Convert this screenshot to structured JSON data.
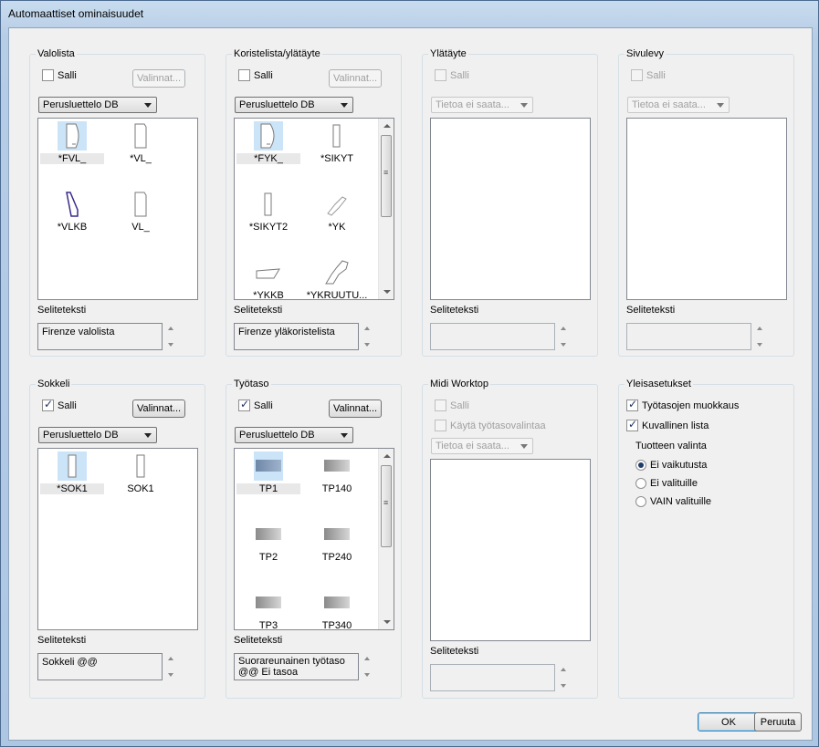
{
  "window": {
    "title": "Automaattiset ominaisuudet"
  },
  "valolista": {
    "legend": "Valolista",
    "salli": "Salli",
    "salli_checked": false,
    "valinnat": "Valinnat...",
    "dropdown": "Perusluettelo DB",
    "items": [
      "*FVL_",
      "*VL_",
      "*VLKB",
      "VL_"
    ],
    "selitelabel": "Seliteteksti",
    "selite": "Firenze valolista"
  },
  "koristelista": {
    "legend": "Koristelista/ylätäyte",
    "salli": "Salli",
    "salli_checked": false,
    "valinnat": "Valinnat...",
    "dropdown": "Perusluettelo DB",
    "items": [
      "*FYK_",
      "*SIKYT",
      "*SIKYT2",
      "*YK",
      "*YKKB",
      "*YKRUUTU..."
    ],
    "selitelabel": "Seliteteksti",
    "selite": "Firenze yläkoristelista"
  },
  "ylataeyte": {
    "legend": "Ylätäyte",
    "salli": "Salli",
    "dropdown": "Tietoa ei saata...",
    "selitelabel": "Seliteteksti",
    "selite": ""
  },
  "sivulevy": {
    "legend": "Sivulevy",
    "salli": "Salli",
    "dropdown": "Tietoa ei saata...",
    "selitelabel": "Seliteteksti",
    "selite": ""
  },
  "sokkeli": {
    "legend": "Sokkeli",
    "salli": "Salli",
    "salli_checked": true,
    "valinnat": "Valinnat...",
    "dropdown": "Perusluettelo DB",
    "items": [
      "*SOK1",
      "SOK1"
    ],
    "selitelabel": "Seliteteksti",
    "selite": "Sokkeli @@"
  },
  "tyotaso": {
    "legend": "Työtaso",
    "salli": "Salli",
    "salli_checked": true,
    "valinnat": "Valinnat...",
    "dropdown": "Perusluettelo DB",
    "items": [
      "TP1",
      "TP140",
      "TP2",
      "TP240",
      "TP3",
      "TP340"
    ],
    "selitelabel": "Seliteteksti",
    "selite_line1": "Suorareunainen työtaso",
    "selite_line2": "@@ Ei tasoa"
  },
  "midi": {
    "legend": "Midi Worktop",
    "salli": "Salli",
    "kayta": "Käytä työtasovalintaa",
    "dropdown": "Tietoa ei saata...",
    "selitelabel": "Seliteteksti",
    "selite": ""
  },
  "yleis": {
    "legend": "Yleisasetukset",
    "tyotasojen": "Työtasojen muokkaus",
    "kuvallinen": "Kuvallinen lista",
    "tuotteen": "Tuotteen valinta",
    "radios": [
      "Ei vaikutusta",
      "Ei valituille",
      "VAIN valituille"
    ],
    "selected_radio": "Ei vaikutusta"
  },
  "footer": {
    "ok": "OK",
    "cancel": "Peruuta"
  }
}
